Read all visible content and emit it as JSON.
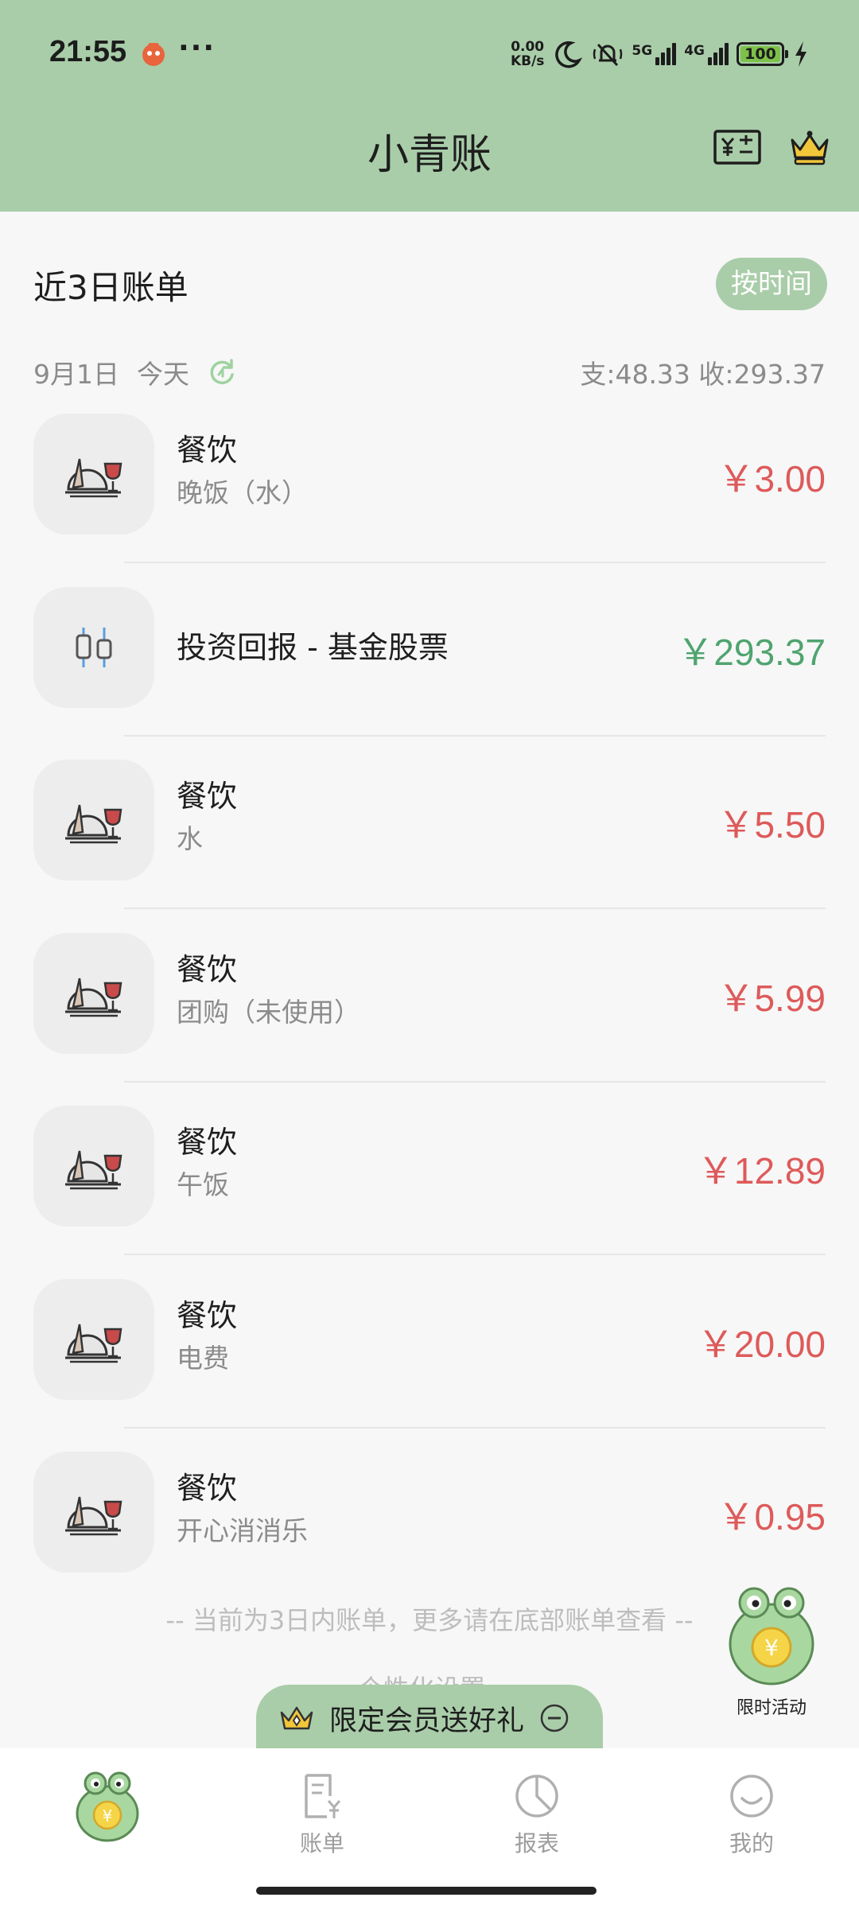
{
  "status_bar": {
    "time": "21:55",
    "more": "···",
    "net_speed_value": "0.00",
    "net_speed_unit": "KB/s",
    "signal_1_label": "5G",
    "signal_2_label": "4G",
    "battery": "100",
    "icons": [
      "dnd-moon-icon",
      "mute-bell-icon",
      "charging-bolt-icon"
    ]
  },
  "header": {
    "title": "小青账",
    "buttons": [
      "currency-calc-icon",
      "crown-icon"
    ]
  },
  "section": {
    "title": "近3日账单",
    "sort_label": "按时间"
  },
  "day": {
    "date": "9月1日",
    "day_label": "今天",
    "summary": "支:48.33  收:293.37"
  },
  "transactions": [
    {
      "category": "餐饮",
      "note": "晚饭（水）",
      "amount": "￥3.00",
      "type": "expense",
      "icon": "dining-icon"
    },
    {
      "category": "投资回报 - 基金股票",
      "note": "",
      "amount": "￥293.37",
      "type": "income",
      "icon": "candlestick-icon"
    },
    {
      "category": "餐饮",
      "note": "水",
      "amount": "￥5.50",
      "type": "expense",
      "icon": "dining-icon"
    },
    {
      "category": "餐饮",
      "note": "团购（未使用）",
      "amount": "￥5.99",
      "type": "expense",
      "icon": "dining-icon"
    },
    {
      "category": "餐饮",
      "note": "午饭",
      "amount": "￥12.89",
      "type": "expense",
      "icon": "dining-icon"
    },
    {
      "category": "餐饮",
      "note": "电费",
      "amount": "￥20.00",
      "type": "expense",
      "icon": "dining-icon"
    },
    {
      "category": "餐饮",
      "note": "开心消消乐",
      "amount": "￥0.95",
      "type": "expense",
      "icon": "dining-icon"
    }
  ],
  "footnote": "-- 当前为3日内账单，更多请在底部账单查看 --",
  "partial_text": "个性化设置",
  "promo": {
    "label": "限时活动"
  },
  "member_banner": {
    "text": "限定会员送好礼"
  },
  "bottom_nav": [
    {
      "label": "",
      "icon": "frog-home-icon"
    },
    {
      "label": "账单",
      "icon": "bill-icon"
    },
    {
      "label": "报表",
      "icon": "pie-chart-icon"
    },
    {
      "label": "我的",
      "icon": "smile-icon"
    }
  ],
  "colors": {
    "header_green": "#a9cda9",
    "expense_red": "#de5a5a",
    "income_green": "#4fa46f"
  }
}
